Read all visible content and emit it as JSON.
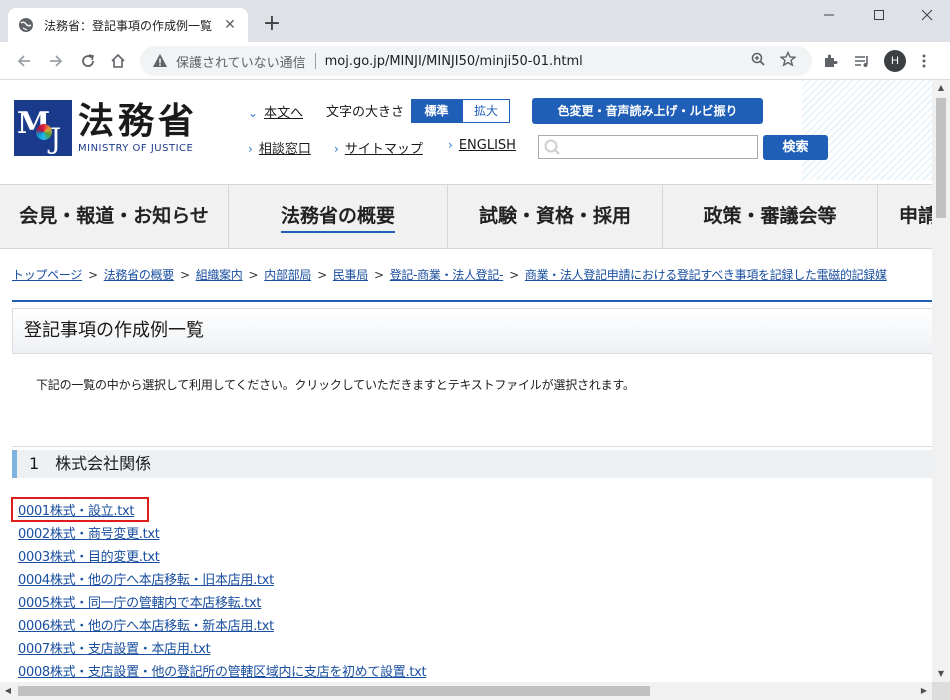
{
  "browser": {
    "tab_title": "法務省：登記事項の作成例一覧",
    "security_text": "保護されていない通信",
    "url": "moj.go.jp/MINJI/MINJI50/minji50-01.html",
    "profile_initial": "H"
  },
  "header": {
    "logo_kanji": "法務省",
    "logo_english": "MINISTRY OF JUSTICE",
    "links": {
      "main_text": "本文へ",
      "consult": "相談窓口",
      "sitemap": "サイトマップ",
      "english": "ENGLISH"
    },
    "font_size_label": "文字の大きさ",
    "font_standard": "標準",
    "font_large": "拡大",
    "color_button": "色変更・音声読み上げ・ルビ振り",
    "search_placeholder": "",
    "search_button": "検索"
  },
  "global_nav": [
    {
      "label": "会見・報道・お知らせ"
    },
    {
      "label": "法務省の概要"
    },
    {
      "label": "試験・資格・採用"
    },
    {
      "label": "政策・審議会等"
    },
    {
      "label": "申請"
    }
  ],
  "breadcrumb": [
    "トップページ",
    "法務省の概要",
    "組織案内",
    "内部部局",
    "民事局",
    "登記-商業・法人登記-",
    "商業・法人登記申請における登記すべき事項を記録した電磁的記録媒"
  ],
  "page": {
    "title": "登記事項の作成例一覧",
    "intro": "下記の一覧の中から選択して利用してください。クリックしていただきますとテキストファイルが選択されます。",
    "section_heading": "1　株式会社関係",
    "files": [
      "0001株式・設立.txt",
      "0002株式・商号変更.txt",
      "0003株式・目的変更.txt",
      "0004株式・他の庁へ本店移転・旧本店用.txt",
      "0005株式・同一庁の管轄内で本店移転.txt",
      "0006株式・他の庁へ本店移転・新本店用.txt",
      "0007株式・支店設置・本店用.txt",
      "0008株式・支店設置・他の登記所の管轄区域内に支店を初めて設置.txt"
    ]
  },
  "colors": {
    "accent_blue": "#1f5fb8",
    "link": "#1a4fa0",
    "highlight_red": "#e01b1b"
  }
}
